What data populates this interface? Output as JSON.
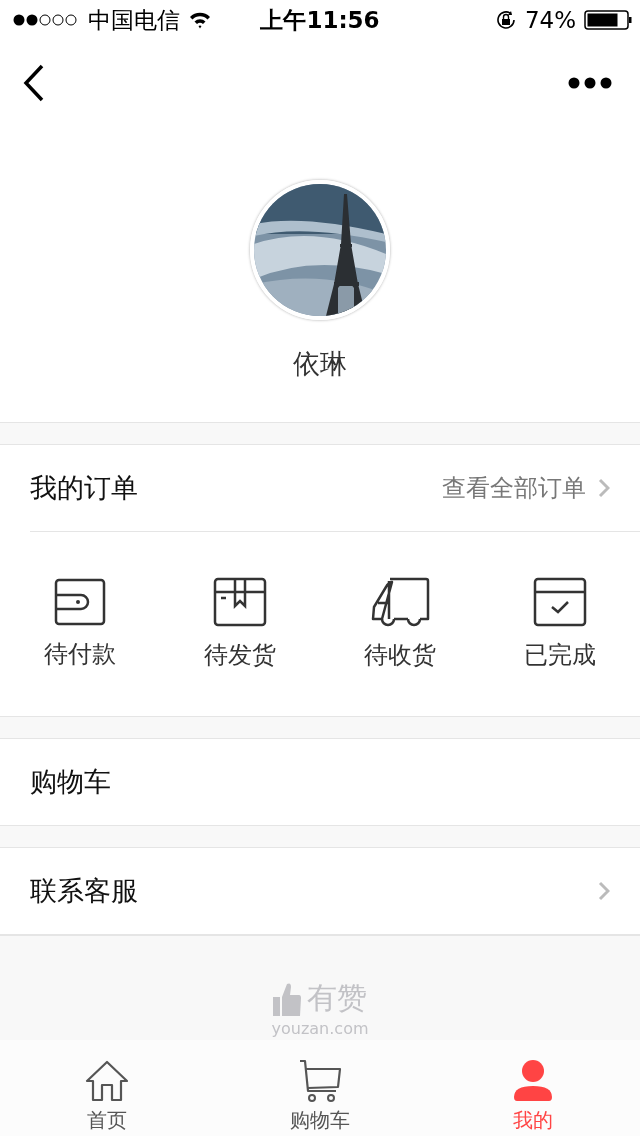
{
  "status_bar": {
    "carrier": "中国电信",
    "time": "上午11:56",
    "battery": "74%"
  },
  "profile": {
    "name": "依琳"
  },
  "orders": {
    "title": "我的订单",
    "view_all": "查看全部订单",
    "items": [
      {
        "kind": "wallet",
        "label": "待付款"
      },
      {
        "kind": "box",
        "label": "待发货"
      },
      {
        "kind": "truck",
        "label": "待收货"
      },
      {
        "kind": "done",
        "label": "已完成"
      }
    ]
  },
  "menu": [
    {
      "label": "购物车",
      "chevron": false
    },
    {
      "label": "联系客服",
      "chevron": true
    }
  ],
  "footer": {
    "brand": "有赞",
    "domain": "youzan.com"
  },
  "tabbar": [
    {
      "kind": "home",
      "label": "首页",
      "selected": false
    },
    {
      "kind": "cart",
      "label": "购物车",
      "selected": false
    },
    {
      "kind": "user",
      "label": "我的",
      "selected": true
    }
  ]
}
